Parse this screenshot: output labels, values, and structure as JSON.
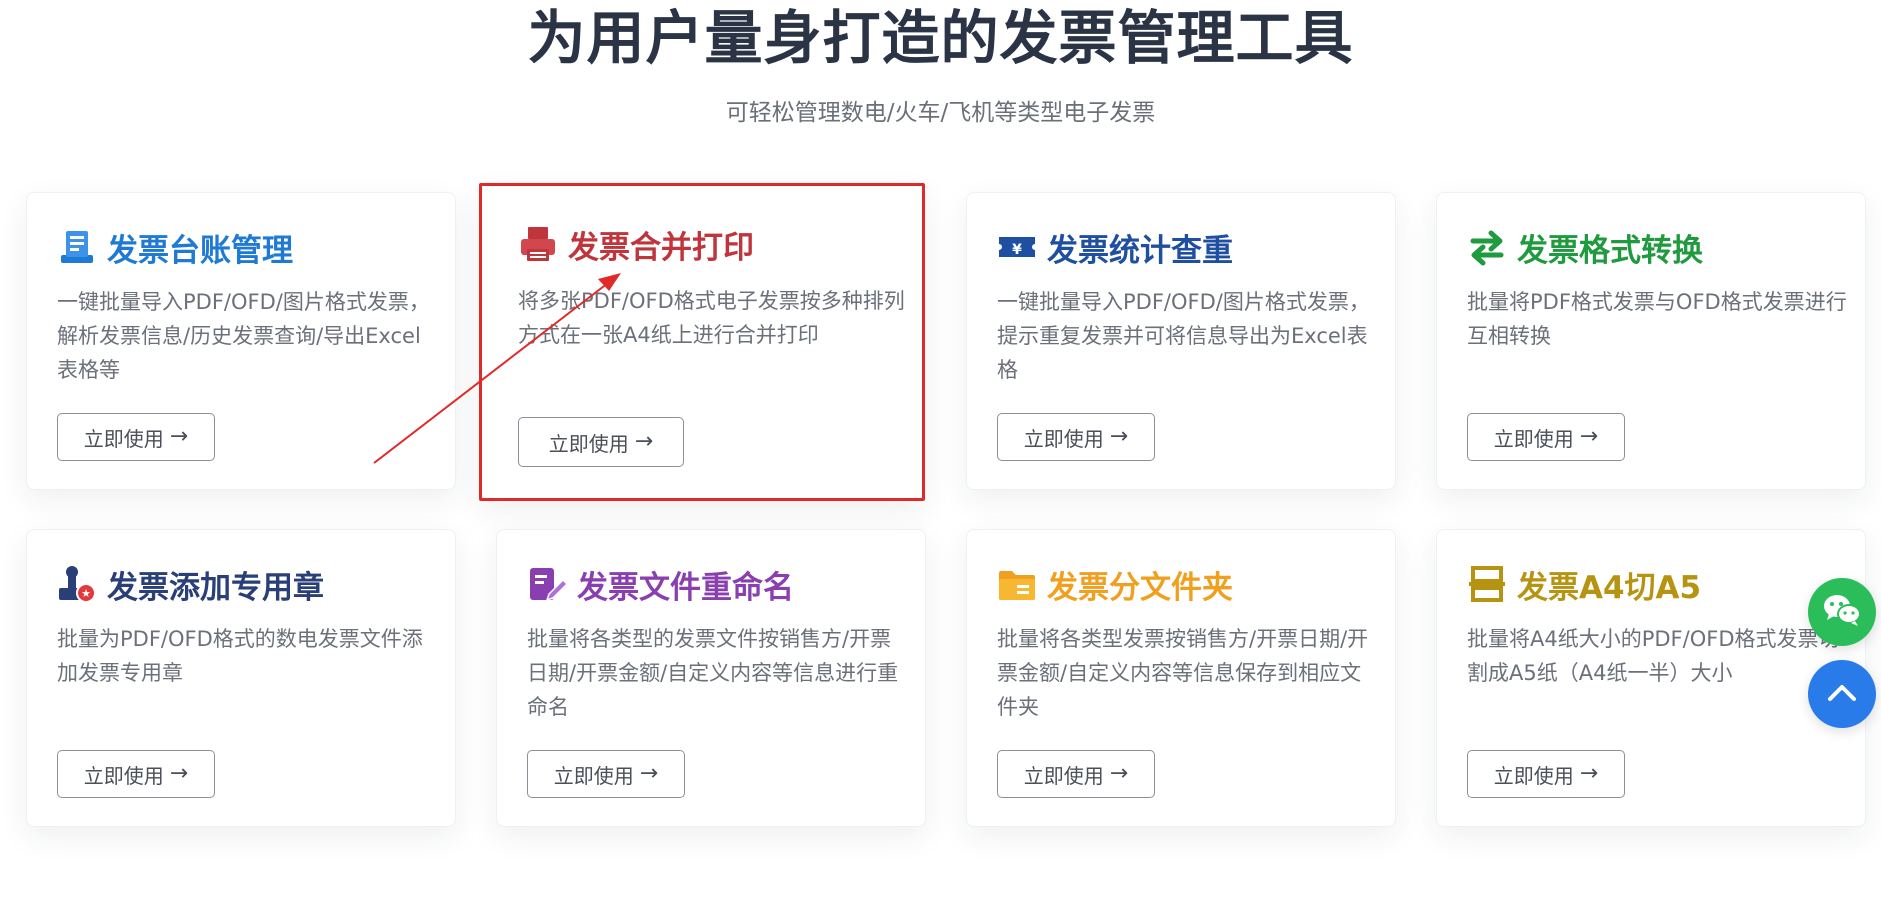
{
  "hero": {
    "title": "为用户量身打造的发票管理工具",
    "subtitle": "可轻松管理数电/火车/飞机等类型电子发票"
  },
  "cards": [
    {
      "title": "发票台账管理",
      "title_color": "#1f7ad6",
      "icon": "ledger-icon",
      "description": "一键批量导入PDF/OFD/图片格式发票，解析发票信息/历史发票查询/导出Excel表格等",
      "button": "立即使用",
      "highlighted": false
    },
    {
      "title": "发票合并打印",
      "title_color": "#c0343b",
      "icon": "printer-icon",
      "description": "将多张PDF/OFD格式电子发票按多种排列方式在一张A4纸上进行合并打印",
      "button": "立即使用",
      "highlighted": true
    },
    {
      "title": "发票统计查重",
      "title_color": "#1f4fa0",
      "icon": "yen-ticket-icon",
      "description": "一键批量导入PDF/OFD/图片格式发票，提示重复发票并可将信息导出为Excel表格",
      "button": "立即使用",
      "highlighted": false
    },
    {
      "title": "发票格式转换",
      "title_color": "#1f9a3e",
      "icon": "swap-arrows-icon",
      "description": "批量将PDF格式发票与OFD格式发票进行互相转换",
      "button": "立即使用",
      "highlighted": false
    },
    {
      "title": "发票添加专用章",
      "title_color": "#2a3e77",
      "icon": "stamp-icon",
      "description": "批量为PDF/OFD格式的数电发票文件添加发票专用章",
      "button": "立即使用",
      "highlighted": false
    },
    {
      "title": "发票文件重命名",
      "title_color": "#8a3fb0",
      "icon": "edit-file-icon",
      "description": "批量将各类型的发票文件按销售方/开票日期/开票金额/自定义内容等信息进行重命名",
      "button": "立即使用",
      "highlighted": false
    },
    {
      "title": "发票分文件夹",
      "title_color": "#f0a01e",
      "icon": "folder-icon",
      "description": "批量将各类型发票按销售方/开票日期/开票金额/自定义内容等信息保存到相应文件夹",
      "button": "立即使用",
      "highlighted": false
    },
    {
      "title": "发票A4切A5",
      "title_color": "#b79312",
      "icon": "cut-page-icon",
      "description": "批量将A4纸大小的PDF/OFD格式发票切割成A5纸（A4纸一半）大小",
      "button": "立即使用",
      "highlighted": false
    }
  ],
  "floating": {
    "chat_icon": "wechat-icon",
    "chat_color": "#2bbd5a",
    "top_icon": "chevron-up-icon",
    "top_color": "#2a7bea"
  },
  "annotation": {
    "color": "#e02a2a"
  }
}
